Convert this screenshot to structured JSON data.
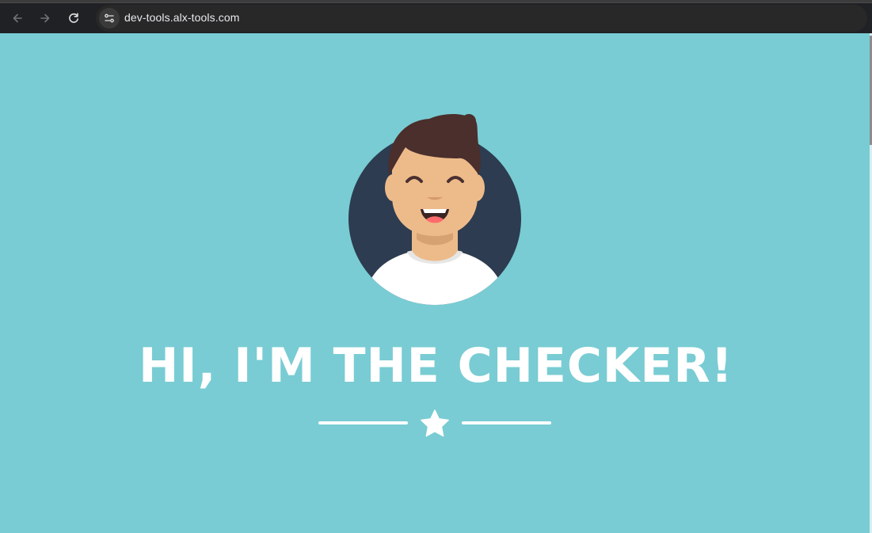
{
  "browser": {
    "url": "dev-tools.alx-tools.com",
    "back_icon": "arrow-left",
    "forward_icon": "arrow-right",
    "reload_icon": "reload",
    "site_info_icon": "tune"
  },
  "page": {
    "background_color": "#79ccd3",
    "headline": "HI, I'M THE CHECKER!",
    "avatar": "smiling-man-avatar",
    "divider_icon": "star"
  }
}
